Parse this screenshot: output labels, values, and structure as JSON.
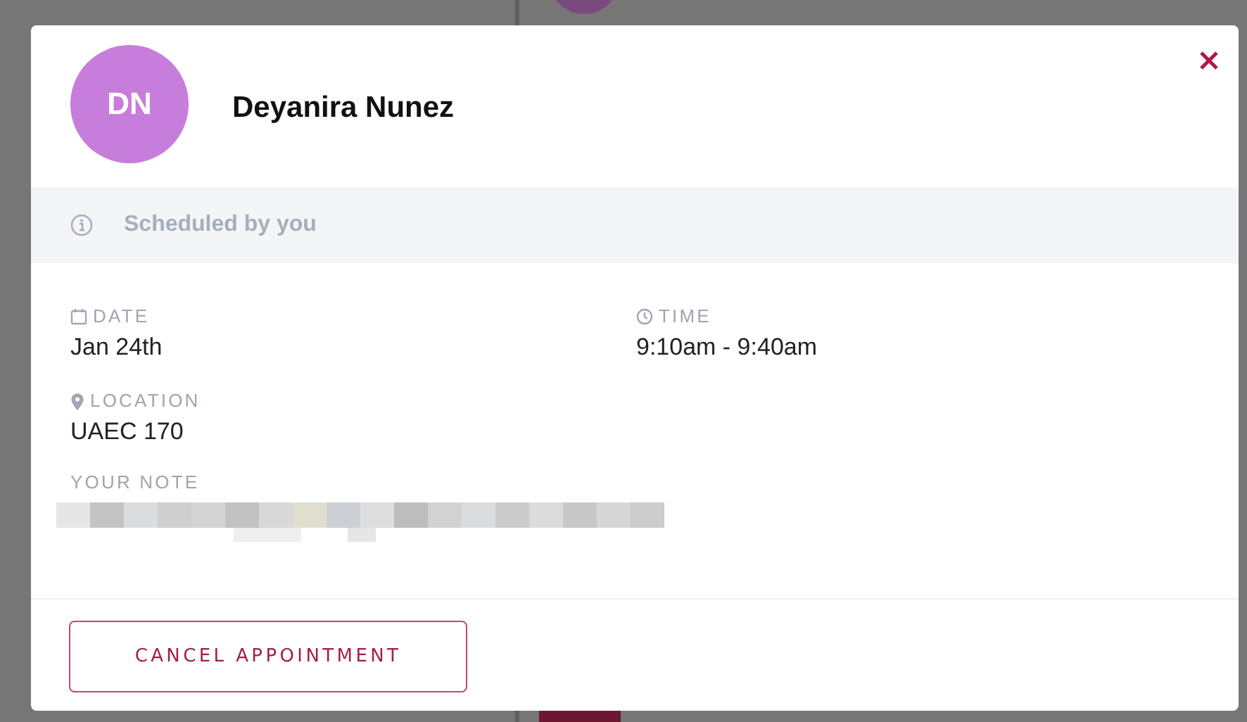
{
  "contact": {
    "initials": "DN",
    "name": "Deyanira Nunez"
  },
  "notice": {
    "text": "Scheduled by you"
  },
  "details": [
    {
      "kind": "date",
      "label": "DATE",
      "value": "Jan 24th"
    },
    {
      "kind": "time",
      "label": "TIME",
      "value": "9:10am - 9:40am"
    },
    {
      "kind": "location",
      "label": "LOCATION",
      "value": "UAEC 170"
    }
  ],
  "note": {
    "label": "YOUR NOTE"
  },
  "actions": [
    {
      "label": "CANCEL APPOINTMENT"
    }
  ]
}
